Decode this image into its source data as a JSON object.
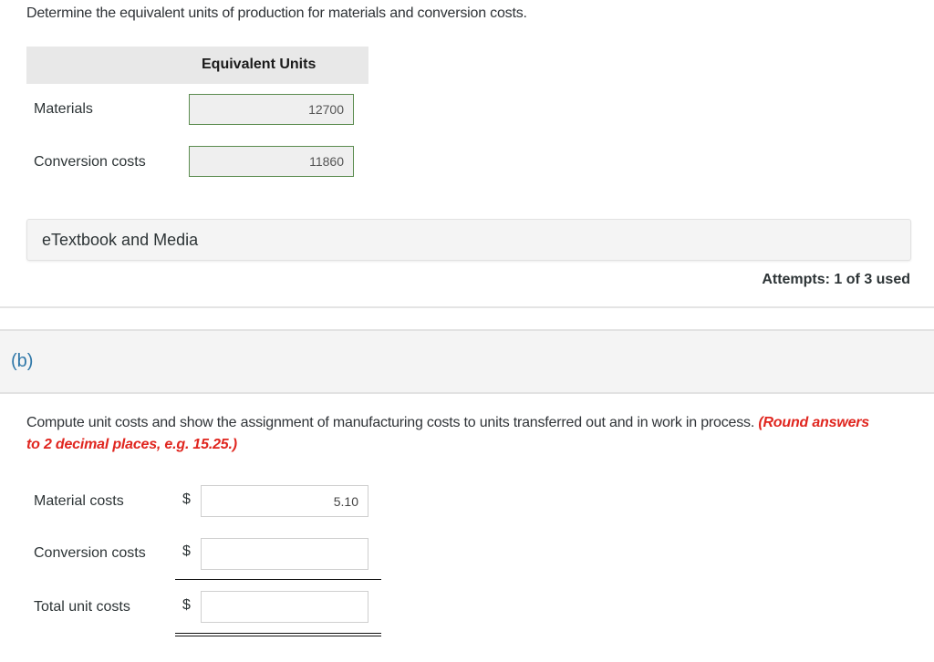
{
  "part_a": {
    "instruction": "Determine the equivalent units of production for materials and conversion costs.",
    "column_header": "Equivalent Units",
    "rows": [
      {
        "label": "Materials",
        "value": "12700"
      },
      {
        "label": "Conversion costs",
        "value": "11860"
      }
    ],
    "etextbook_label": "eTextbook and Media",
    "attempts": "Attempts: 1 of 3 used"
  },
  "part_b": {
    "label": "(b)",
    "instruction": "Compute unit costs and show the assignment of manufacturing costs to units transferred out and in work in process.",
    "instruction_note": "(Round answers to 2 decimal places, e.g. 15.25.)",
    "currency_symbol": "$",
    "rows": [
      {
        "label": "Material costs",
        "value": "5.10"
      },
      {
        "label": "Conversion costs",
        "value": ""
      },
      {
        "label": "Total unit costs",
        "value": ""
      }
    ]
  },
  "colors": {
    "accent_blue": "#2e77a8",
    "note_red": "#e0261f",
    "answered_border_green": "#5b8c4f"
  }
}
